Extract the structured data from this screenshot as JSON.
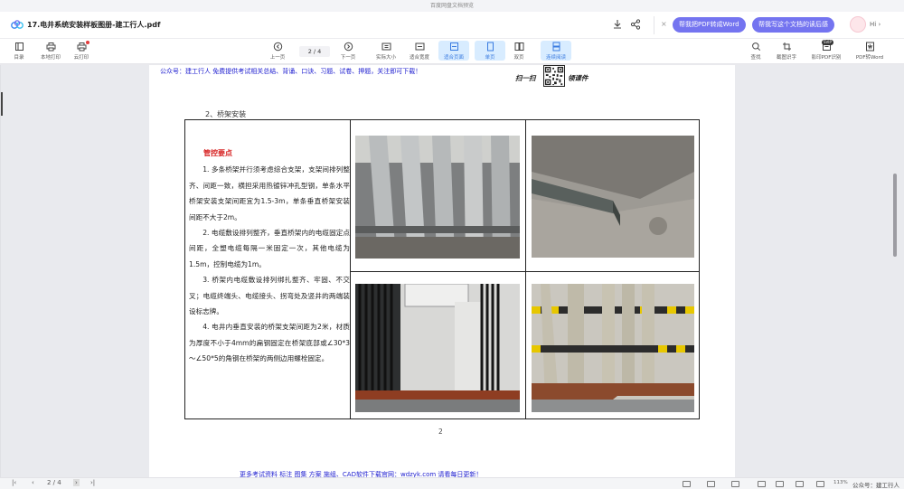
{
  "window": {
    "title": "百度网盘文档预览"
  },
  "header": {
    "file_name": "17.电井系统安装样板图册-建工行人.pdf",
    "pill_word": "帮我把PDF转成Word",
    "pill_summary": "帮我写这个文档的读后感",
    "hi": "Hi"
  },
  "toolbar": {
    "left": [
      {
        "label": "目录",
        "icon": "catalog-icon"
      },
      {
        "label": "本地打印",
        "icon": "print-icon"
      },
      {
        "label": "云打印",
        "icon": "cloud-print-icon"
      }
    ],
    "center": [
      {
        "label": "上一页",
        "icon": "prev-page-icon"
      },
      {
        "label": "下一页",
        "icon": "next-page-icon"
      },
      {
        "label": "实际大小",
        "icon": "actual-size-icon"
      },
      {
        "label": "适合宽度",
        "icon": "fit-width-icon"
      },
      {
        "label": "适合页面",
        "icon": "fit-page-icon",
        "active": true
      },
      {
        "label": "单页",
        "icon": "single-page-icon",
        "active": true
      },
      {
        "label": "双页",
        "icon": "double-page-icon"
      },
      {
        "label": "连续阅读",
        "icon": "continuous-icon",
        "active": true
      }
    ],
    "page_box": "2 / 4",
    "right": [
      {
        "label": "查找",
        "icon": "search-icon"
      },
      {
        "label": "截图识字",
        "icon": "screenshot-ocr-icon"
      },
      {
        "label": "影印PDF识别",
        "icon": "scan-pdf-icon",
        "badge": "SVIP"
      },
      {
        "label": "PDF转Word",
        "icon": "pdf-word-icon"
      }
    ]
  },
  "document": {
    "notice": "公众号：建工行人 免费提供考试相关总结、背诵、口诀、习题、试卷、押题，关注即可下载！",
    "qr_left": "扫一扫",
    "qr_right": "领课件",
    "section_title": "2、桥架安装",
    "red_title": "管控要点",
    "paragraphs": [
      "1. 多条桥架并行须考虑综合支架，支架间排列整齐、间距一致，横担采用热镀锌冲孔型钢，单条水平桥架安装支架间距宜为1.5-3m，单条垂直桥架安装间距不大于2m。",
      "2. 电缆敷设排列整齐，垂直桥架内的电缆固定点间距，全塑电缆每隔一米固定一次，其他电缆为1.5m，控制电缆为1m。",
      "3. 桥架内电缆敷设排列绑扎整齐、牢固、不交叉；电缆终端头、电缆接头、拐弯处及竖井的两端装设标志牌。",
      "4. 电井内垂直安装的桥架支架间距为2米，材质为厚度不小于4mm的扁钢固定在桥架底部或∠30*3～∠50*5的角钢在桥架的两侧边用螺栓固定。"
    ],
    "page_number": "2",
    "footer": "更多考试资料 标注 图集 方案 施组、CAD软件下载官网：wdzyk.com 请看每日更新！"
  },
  "statusbar": {
    "page_box": "2 / 4",
    "zoom": "113%",
    "watermark": "公众号：建工行人"
  }
}
